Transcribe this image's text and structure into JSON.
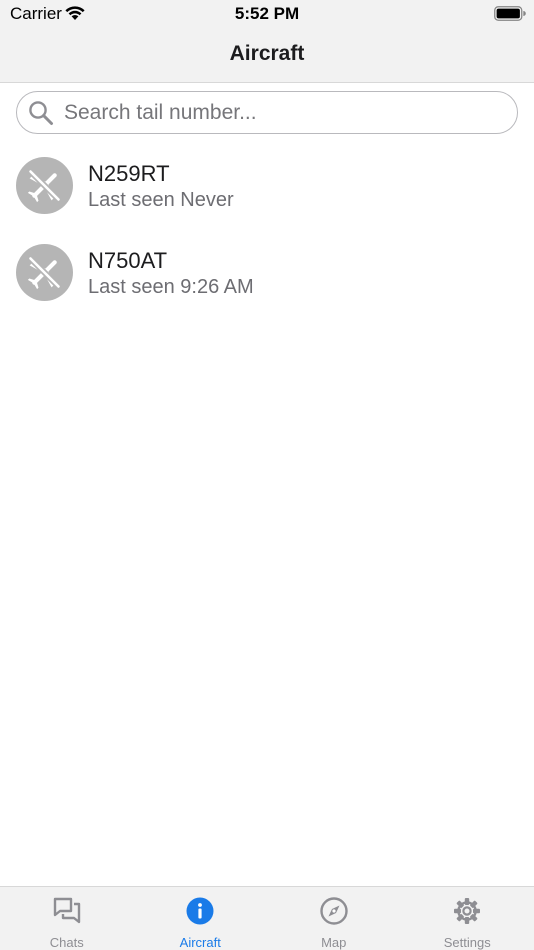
{
  "status_bar": {
    "carrier": "Carrier",
    "time": "5:52 PM"
  },
  "nav": {
    "title": "Aircraft"
  },
  "search": {
    "placeholder": "Search tail number...",
    "value": ""
  },
  "aircraft": [
    {
      "tail": "N259RT",
      "last_seen": "Last seen Never",
      "icon": "airplane-off-icon"
    },
    {
      "tail": "N750AT",
      "last_seen": "Last seen 9:26 AM",
      "icon": "airplane-off-icon"
    }
  ],
  "tabs": [
    {
      "label": "Chats",
      "icon": "chats-icon",
      "active": false
    },
    {
      "label": "Aircraft",
      "icon": "info-icon",
      "active": true
    },
    {
      "label": "Map",
      "icon": "compass-icon",
      "active": false
    },
    {
      "label": "Settings",
      "icon": "gear-icon",
      "active": false
    }
  ],
  "colors": {
    "accent": "#1a7be8",
    "avatar_bg": "#b5b5b5",
    "inactive": "#8e8e93",
    "bar_bg": "#f2f2f2"
  }
}
